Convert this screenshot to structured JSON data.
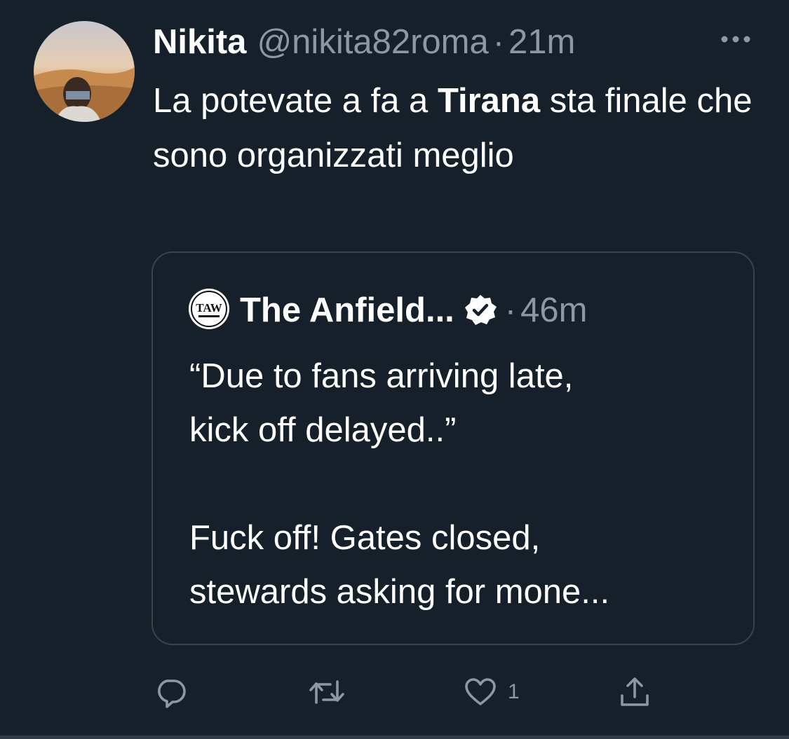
{
  "tweet": {
    "author_name": "Nikita",
    "handle": "@nikita82roma",
    "separator": "·",
    "time": "21m",
    "text_before": "La potevate a fa a ",
    "text_bold": "Tirana",
    "text_after": " sta finale che sono organizzati meglio",
    "like_count": "1"
  },
  "quoted_tweet": {
    "author_name": "The Anfield...",
    "separator": "·",
    "time": "46m",
    "avatar_text": "TAW",
    "text": "“Due to fans arriving late,\nkick off delayed..”\n\nFuck off! Gates closed,\nstewards asking for mone..."
  },
  "icons": {
    "more": "more-horizontal-icon",
    "verified": "verified-badge-icon",
    "reply": "reply-icon",
    "retweet": "retweet-icon",
    "like": "heart-icon",
    "share": "share-icon"
  },
  "colors": {
    "background": "#15202b",
    "text_primary": "#ffffff",
    "text_secondary": "#8b98a5",
    "border": "#38444d"
  }
}
